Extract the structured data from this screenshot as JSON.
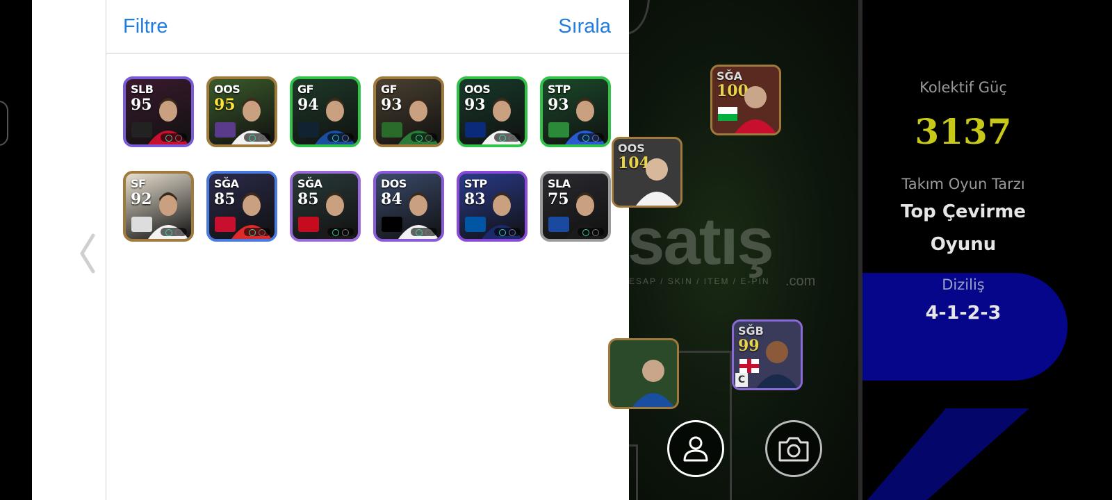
{
  "header": {
    "filter_label": "Filtre",
    "sort_label": "Sırala"
  },
  "players": [
    {
      "pos": "SLB",
      "ovr": "95",
      "frame": "#7a5bd8",
      "bg": "#3a1a2e",
      "shirt": "#c8102e",
      "badge_bg": "#222",
      "gold": false
    },
    {
      "pos": "OOS",
      "ovr": "95",
      "frame": "#a07a3c",
      "bg": "#3a5a2a",
      "shirt": "#f2f2f2",
      "badge_bg": "#5a3a8a",
      "gold": true
    },
    {
      "pos": "GF",
      "ovr": "94",
      "frame": "#32c24a",
      "bg": "#1e3a28",
      "shirt": "#1a4fa0",
      "badge_bg": "#123",
      "gold": false
    },
    {
      "pos": "GF",
      "ovr": "93",
      "frame": "#a07a3c",
      "bg": "#4a4030",
      "shirt": "#2a7a3a",
      "badge_bg": "#2a6a2a",
      "gold": false
    },
    {
      "pos": "OOS",
      "ovr": "93",
      "frame": "#32c24a",
      "bg": "#173a2a",
      "shirt": "#f4f4f4",
      "badge_bg": "#0a2a7a",
      "gold": false
    },
    {
      "pos": "STP",
      "ovr": "93",
      "frame": "#32c24a",
      "bg": "#1a4a2a",
      "shirt": "#2a5ad0",
      "badge_bg": "#2a8a3a",
      "gold": false
    },
    {
      "pos": "SF",
      "ovr": "92",
      "frame": "#a07a3c",
      "bg": "#e8e0d0",
      "shirt": "#f2f2f2",
      "badge_bg": "#ddd",
      "gold": false
    },
    {
      "pos": "SĞA",
      "ovr": "85",
      "frame": "#4a7ae0",
      "bg": "#2a2a4a",
      "shirt": "#e02a2a",
      "badge_bg": "#c8102e",
      "gold": false
    },
    {
      "pos": "SĞA",
      "ovr": "85",
      "frame": "#9a6ad8",
      "bg": "#2a3a3a",
      "shirt": "#1a1a1a",
      "badge_bg": "#c60b1e",
      "gold": false
    },
    {
      "pos": "DOS",
      "ovr": "84",
      "frame": "#8a5ad8",
      "bg": "#3a4a6a",
      "shirt": "#f2f2f2",
      "badge_bg": "#000",
      "gold": false
    },
    {
      "pos": "STP",
      "ovr": "83",
      "frame": "#8a4ad8",
      "bg": "#2a3a8a",
      "shirt": "#1a2a6a",
      "badge_bg": "#0055a4",
      "gold": false
    },
    {
      "pos": "SLA",
      "ovr": "75",
      "frame": "#9a9a9a",
      "bg": "#2a2a30",
      "shirt": "#1a1a1a",
      "badge_bg": "#1a4aa0",
      "gold": false
    }
  ],
  "pitch_players": [
    {
      "pos": "SĞA",
      "ovr": "100"
    },
    {
      "pos": "OOS",
      "ovr": "104"
    },
    {
      "pos": "SĞB",
      "ovr": "99"
    }
  ],
  "captain_mark": "C",
  "watermark": {
    "main": "satış",
    "sub": "ESAP / SKIN / ITEM / E-PIN",
    "com": ".com"
  },
  "stats": {
    "collective_label": "Kolektif Güç",
    "collective_value": "3137",
    "playstyle_label": "Takım Oyun Tarzı",
    "playstyle_line1": "Top Çevirme",
    "playstyle_line2": "Oyunu",
    "formation_label": "Diziliş",
    "formation_value": "4-1-2-3"
  },
  "icons": [
    "chevron-left-icon",
    "user-icon",
    "camera-icon"
  ]
}
